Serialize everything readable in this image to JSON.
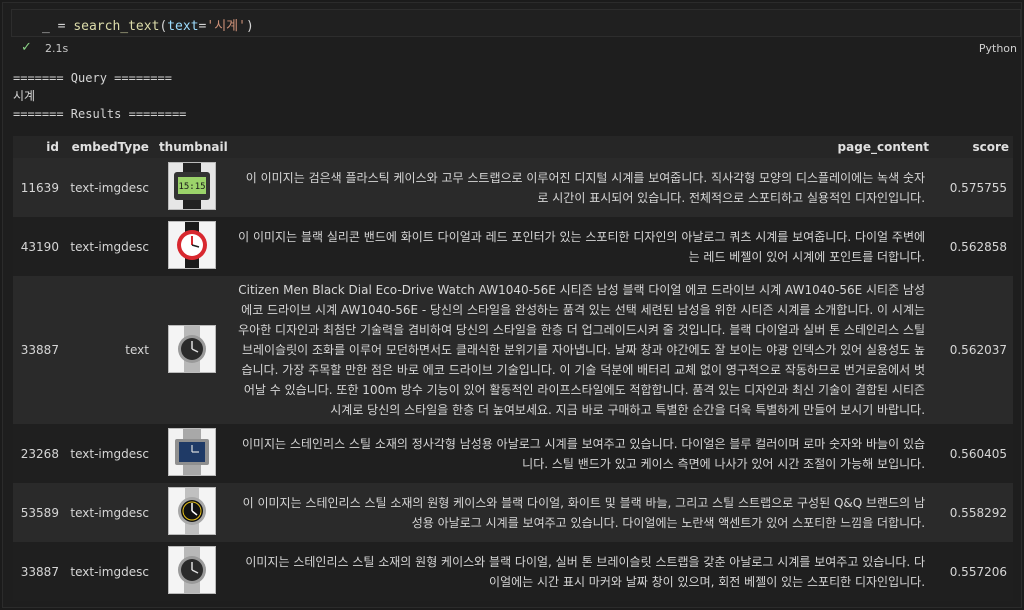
{
  "cell": {
    "code_prefix": "_ = ",
    "code_fn": "search_text",
    "code_paren_open": "(",
    "code_param": "text",
    "code_eq": "=",
    "code_str": "'시계'",
    "code_paren_close": ")",
    "exec_time": "2.1s",
    "kernel": "Python"
  },
  "output": {
    "query_header": "======= Query ========",
    "query": "시계",
    "results_header": "======= Results ========"
  },
  "table": {
    "columns": [
      "id",
      "embedType",
      "thumbnail",
      "page_content",
      "score"
    ],
    "rows": [
      {
        "id": "11639",
        "embedType": "text-imgdesc",
        "thumbnail": "digital-watch-thumbnail",
        "page_content": "이 이미지는 검은색 플라스틱 케이스와 고무 스트랩으로 이루어진 디지털 시계를 보여줍니다. 직사각형 모양의 디스플레이에는 녹색 숫자로 시간이 표시되어 있습니다. 전체적으로 스포티하고 실용적인 디자인입니다.",
        "score": "0.575755"
      },
      {
        "id": "43190",
        "embedType": "text-imgdesc",
        "thumbnail": "red-analog-watch-thumbnail",
        "page_content": "이 이미지는 블랙 실리콘 밴드에 화이트 다이얼과 레드 포인터가 있는 스포티한 디자인의 아날로그 쿼츠 시계를 보여줍니다. 다이얼 주변에는 레드 베젤이 있어 시계에 포인트를 더합니다.",
        "score": "0.562858"
      },
      {
        "id": "33887",
        "embedType": "text",
        "thumbnail": "steel-watch-thumbnail",
        "page_content": "Citizen Men Black Dial Eco-Drive Watch AW1040-56E 시티즌 남성 블랙 다이얼 에코 드라이브 시계 AW1040-56E 시티즌 남성 에코 드라이브 시계 AW1040-56E - 당신의 스타일을 완성하는 품격 있는 선택 세련된 남성을 위한 시티즌 시계를 소개합니다. 이 시계는 우아한 디자인과 최첨단 기술력을 겸비하여 당신의 스타일을 한층 더 업그레이드시켜 줄 것입니다. 블랙 다이얼과 실버 톤 스테인리스 스틸 브레이슬릿이 조화를 이루어 모던하면서도 클래식한 분위기를 자아냅니다. 날짜 창과 야간에도 잘 보이는 야광 인덱스가 있어 실용성도 높습니다. 가장 주목할 만한 점은 바로 에코 드라이브 기술입니다. 이 기술 덕분에 배터리 교체 없이 영구적으로 작동하므로 번거로움에서 벗어날 수 있습니다. 또한 100m 방수 기능이 있어 활동적인 라이프스타일에도 적합합니다. 품격 있는 디자인과 최신 기술이 결합된 시티즌 시계로 당신의 스타일을 한층 더 높여보세요. 지금 바로 구매하고 특별한 순간을 더욱 특별하게 만들어 보시기 바랍니다.",
        "score": "0.562037"
      },
      {
        "id": "23268",
        "embedType": "text-imgdesc",
        "thumbnail": "rectangular-watch-thumbnail",
        "page_content": "이미지는 스테인리스 스틸 소재의 정사각형 남성용 아날로그 시계를 보여주고 있습니다. 다이얼은 블루 컬러이며 로마 숫자와 바늘이 있습니다. 스틸 밴드가 있고 케이스 측면에 나사가 있어 시간 조절이 가능해 보입니다.",
        "score": "0.560405"
      },
      {
        "id": "53589",
        "embedType": "text-imgdesc",
        "thumbnail": "yellow-accent-watch-thumbnail",
        "page_content": "이 이미지는 스테인리스 스틸 소재의 원형 케이스와 블랙 다이얼, 화이트 및 블랙 바늘, 그리고 스틸 스트랩으로 구성된 Q&Q 브랜드의 남성용 아날로그 시계를 보여주고 있습니다. 다이얼에는 노란색 액센트가 있어 스포티한 느낌을 더합니다.",
        "score": "0.558292"
      },
      {
        "id": "33887",
        "embedType": "text-imgdesc",
        "thumbnail": "steel-watch-thumbnail",
        "page_content": "이미지는 스테인리스 스틸 소재의 원형 케이스와 블랙 다이얼, 실버 톤 브레이슬릿 스트랩을 갖춘 아날로그 시계를 보여주고 있습니다. 다이얼에는 시간 표시 마커와 날짜 창이 있으며, 회전 베젤이 있는 스포티한 디자인입니다.",
        "score": "0.557206"
      }
    ]
  },
  "colors": {
    "background": "#1e1e1e",
    "odd_row": "#2a2a2a",
    "success_check": "#89d185",
    "code_function": "#dcdcaa",
    "code_string": "#ce9178",
    "code_param": "#9cdcfe",
    "digital_display": "#9bd36a",
    "watch_red": "#d8282f",
    "watch_yellow": "#e8c21a",
    "watch_blue": "#1f3a66"
  },
  "digital_readout": "15:15"
}
